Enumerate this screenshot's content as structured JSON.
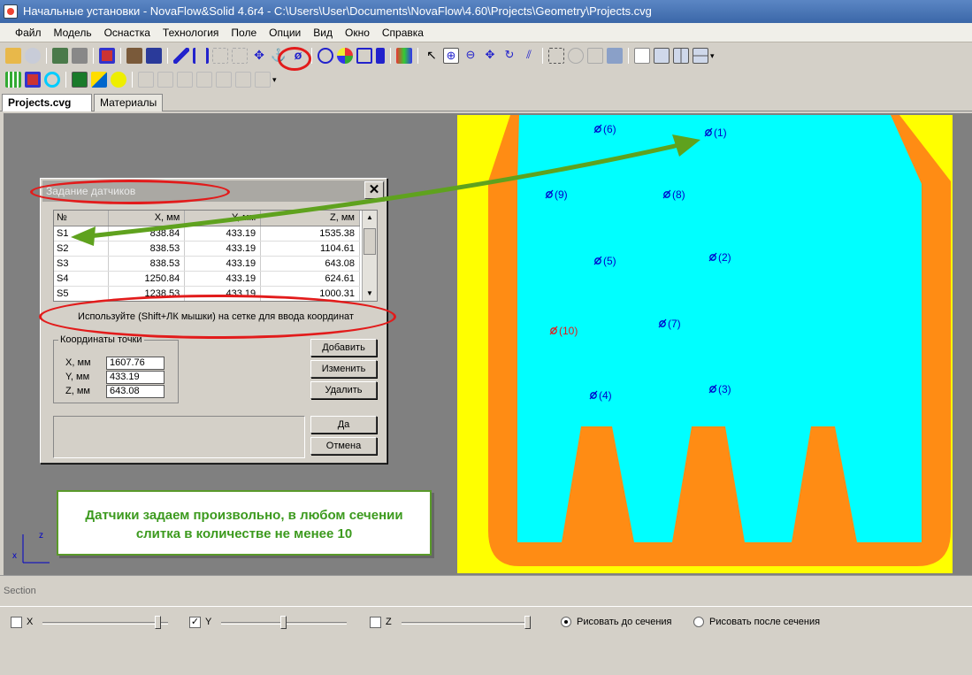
{
  "window": {
    "title": "Начальные установки - NovaFlow&Solid 4.6r4 - C:\\Users\\User\\Documents\\NovaFlow\\4.60\\Projects\\Geometry\\Projects.cvg"
  },
  "menu": [
    "Файл",
    "Модель",
    "Оснастка",
    "Технология",
    "Поле",
    "Опции",
    "Вид",
    "Окно",
    "Справка"
  ],
  "tabs": [
    {
      "label": "Projects.cvg",
      "close": "✕"
    },
    {
      "label": "Материалы"
    }
  ],
  "dialog": {
    "title": "Задание датчиков",
    "columns": [
      "№",
      "X, мм",
      "Y, мм",
      "Z, мм"
    ],
    "rows": [
      [
        "S1",
        "838.84",
        "433.19",
        "1535.38"
      ],
      [
        "S2",
        "838.53",
        "433.19",
        "1104.61"
      ],
      [
        "S3",
        "838.53",
        "433.19",
        "643.08"
      ],
      [
        "S4",
        "1250.84",
        "433.19",
        "624.61"
      ],
      [
        "S5",
        "1238.53",
        "433.19",
        "1000.31"
      ]
    ],
    "hint": "Используйте (Shift+ЛК мышки) на сетке для ввода координат",
    "coords": {
      "legend": "Координаты точки",
      "x_label": "X, мм",
      "y_label": "Y, мм",
      "z_label": "Z, мм",
      "x": "1607.76",
      "y": "433.19",
      "z": "643.08"
    },
    "buttons": {
      "add": "Добавить",
      "edit": "Изменить",
      "delete": "Удалить",
      "ok": "Да",
      "cancel": "Отмена"
    }
  },
  "sensors": [
    "(1)",
    "(2)",
    "(3)",
    "(4)",
    "(5)",
    "(6)",
    "(7)",
    "(8)",
    "(9)",
    "(10)"
  ],
  "axes": {
    "z": "z",
    "x": "x"
  },
  "note": {
    "line1": "Датчики задаем произвольно, в любом сечении",
    "line2": "слитка в количестве  не менее 10"
  },
  "section": {
    "label": "Section",
    "x": {
      "label": "X",
      "checked": false
    },
    "y": {
      "label": "Y",
      "checked": true
    },
    "z": {
      "label": "Z",
      "checked": false
    },
    "draw_before": "Рисовать до сечения",
    "draw_after": "Рисовать после сечения"
  },
  "colors": {
    "mold": "#ffff00",
    "shell": "#ff8c14",
    "metal": "#00ffff",
    "sensor": "#0000cc",
    "highlight": "#e21b1b",
    "arrow": "#5fa21e"
  }
}
